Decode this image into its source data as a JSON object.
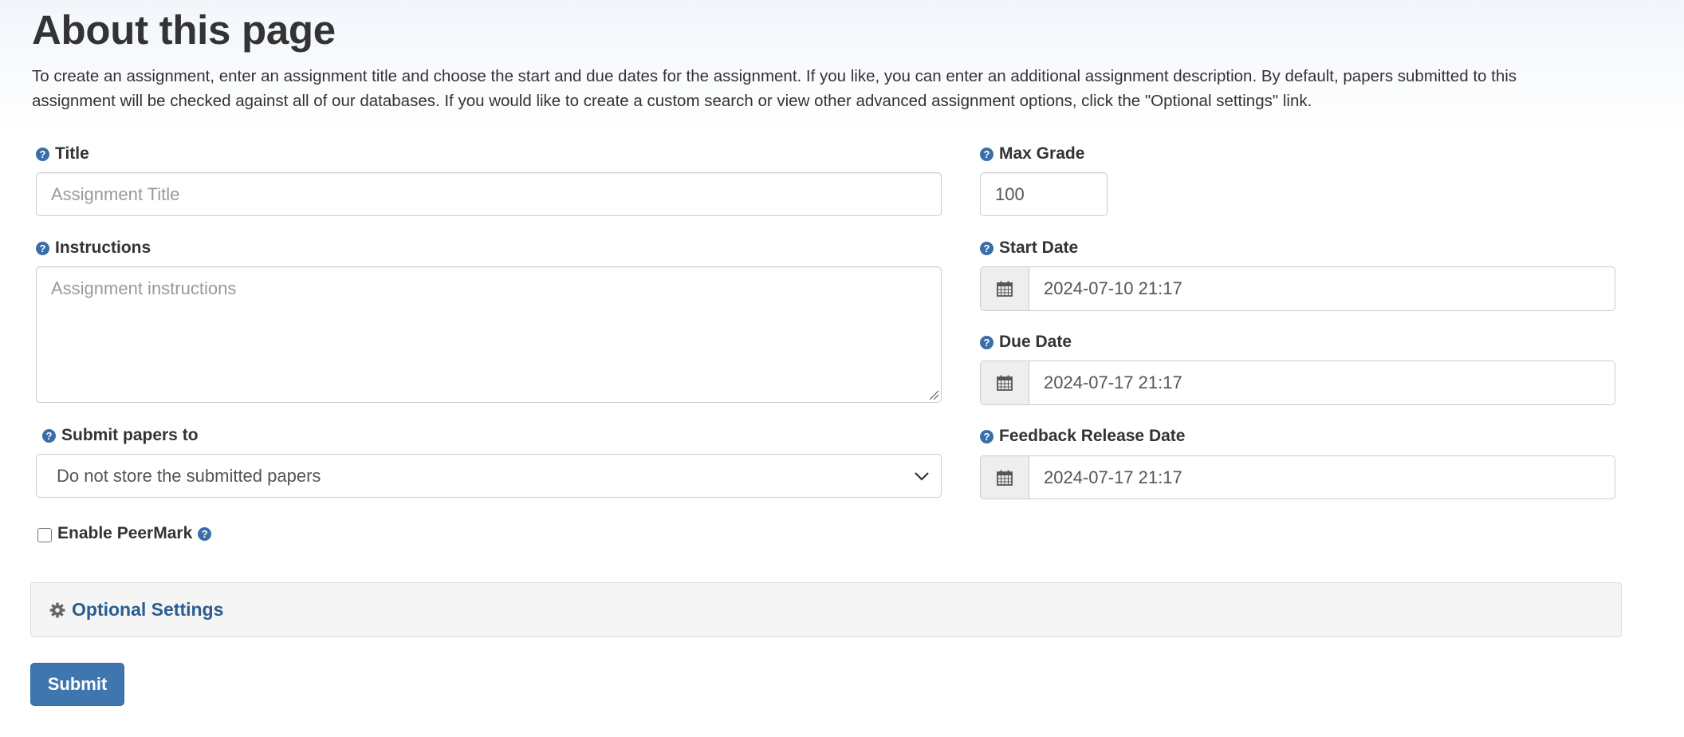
{
  "header": {
    "title": "About this page",
    "description": "To create an assignment, enter an assignment title and choose the start and due dates for the assignment. If you like, you can enter an additional assignment description. By default, papers submitted to this assignment will be checked against all of our databases. If you would like to create a custom search or view other advanced assignment options, click the \"Optional settings\" link."
  },
  "form": {
    "title": {
      "label": "Title",
      "placeholder": "Assignment Title",
      "value": ""
    },
    "instructions": {
      "label": "Instructions",
      "placeholder": "Assignment instructions",
      "value": ""
    },
    "submit_papers_to": {
      "label": "Submit papers to",
      "selected": "Do not store the submitted papers"
    },
    "enable_peermark": {
      "label": "Enable PeerMark",
      "checked": false
    },
    "max_grade": {
      "label": "Max Grade",
      "value": "100"
    },
    "start_date": {
      "label": "Start Date",
      "value": "2024-07-10 21:17"
    },
    "due_date": {
      "label": "Due Date",
      "value": "2024-07-17 21:17"
    },
    "feedback_release_date": {
      "label": "Feedback Release Date",
      "value": "2024-07-17 21:17"
    }
  },
  "optional_settings": {
    "label": "Optional Settings"
  },
  "actions": {
    "submit_label": "Submit"
  },
  "icons": {
    "help": "question-circle-icon",
    "calendar": "calendar-icon",
    "settings": "gear-icon",
    "dropdown": "chevron-down-icon"
  },
  "colors": {
    "help_icon": "#3a6ea8",
    "link": "#2a5d8f",
    "submit_button": "#3f76b0",
    "panel_background": "#f5f5f5"
  }
}
